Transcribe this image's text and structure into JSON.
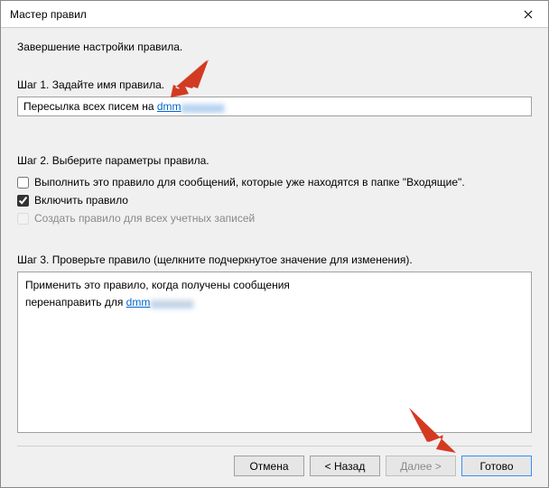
{
  "titlebar": {
    "title": "Мастер правил"
  },
  "heading": "Завершение настройки правила.",
  "step1": {
    "label": "Шаг 1. Задайте имя правила.",
    "value_prefix": "Пересылка всех писем на ",
    "email_visible": "dmm",
    "email_hidden": "xxxxxxxx"
  },
  "step2": {
    "label": "Шаг 2. Выберите параметры правила.",
    "options": [
      {
        "label": "Выполнить это правило для сообщений, которые уже находятся в папке \"Входящие\".",
        "checked": false,
        "disabled": false
      },
      {
        "label": "Включить правило",
        "checked": true,
        "disabled": false
      },
      {
        "label": "Создать правило для всех учетных записей",
        "checked": false,
        "disabled": true
      }
    ]
  },
  "step3": {
    "label": "Шаг 3. Проверьте правило (щелкните подчеркнутое значение для изменения).",
    "line1": "Применить это правило, когда получены сообщения",
    "line2_prefix": "перенаправить для ",
    "email_visible": "dmm",
    "email_hidden": "xxxxxxxx"
  },
  "buttons": {
    "cancel": "Отмена",
    "back": "< Назад",
    "next": "Далее >",
    "finish": "Готово"
  },
  "colors": {
    "arrow": "#d33a22",
    "link": "#0066cc",
    "primary_border": "#3390ff"
  }
}
